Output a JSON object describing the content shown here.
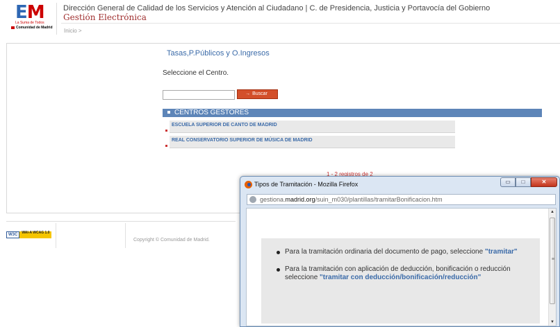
{
  "header": {
    "logo_text": "EM",
    "logo_tagline": "La Suma de Todos",
    "logo_org": "Comunidad de Madrid",
    "title": "Dirección General de Calidad de los Servicios y Atención al Ciudadano | C. de Presidencia, Justicia y Portavocía del Gobierno",
    "subtitle": "Gestión Electrónica",
    "breadcrumb": "Inicio >"
  },
  "main": {
    "section_title": "Tasas,P.Públicos y O.Ingresos",
    "prompt": "Seleccione el Centro.",
    "search_value": "",
    "search_button": "Buscar",
    "centros_header": "CENTROS GESTORES",
    "centros": [
      "ESCUELA SUPERIOR DE CANTO DE MADRID",
      "REAL CONSERVATORIO SUPERIOR DE MÚSICA DE MADRID"
    ],
    "records_text": "1 - 2 registros de 2"
  },
  "footer": {
    "w3c_label": "W3C",
    "wai_label": "WAI-A WCAG 1.0",
    "copyright": "Copyright © Comunidad de Madrid."
  },
  "popup": {
    "title": "Tipos de Tramitación - Mozilla Firefox",
    "url_prefix": "gestiona.",
    "url_domain": "madrid.org",
    "url_path": "/suin_m030/plantillas/tramitarBonificacion.htm",
    "item1_text": "Para la tramitación ordinaria del documento de pago, seleccione",
    "item1_link": "\"tramitar\"",
    "item2_text": "Para la tramitación con aplicación de deducción, bonificación o reducción seleccione",
    "item2_link": "\"tramitar con deducción/bonificación/reducción\"",
    "minimize_glyph": "▭",
    "maximize_glyph": "□",
    "close_glyph": "✕"
  },
  "colors": {
    "accent_blue": "#3a6aa8",
    "header_bar": "#5d85b8",
    "button_red": "#d34f2a",
    "breadcrumb_red": "#a03030"
  }
}
